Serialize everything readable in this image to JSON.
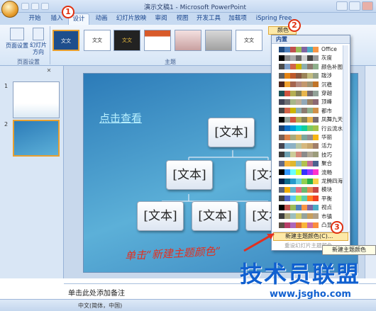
{
  "window": {
    "title": "演示文稿1 - Microsoft PowerPoint"
  },
  "tabs": [
    "开始",
    "插入",
    "设计",
    "动画",
    "幻灯片放映",
    "审阅",
    "视图",
    "开发工具",
    "加载项",
    "iSpring Free"
  ],
  "ribbon": {
    "page_setup": "页面设置",
    "slide_orientation": "幻灯片方向",
    "group_page_setup": "页面设置",
    "group_themes": "主题",
    "theme_thumbs": [
      "文文",
      "文文",
      "文文",
      "",
      "",
      "文文"
    ],
    "colors_button": "颜色"
  },
  "slide": {
    "link_text": "点击查看",
    "node_text": "[文本]"
  },
  "notes": {
    "placeholder": "单击此处添加备注"
  },
  "status": {
    "language": "中文(简体，中国)"
  },
  "dropdown": {
    "header": "内置",
    "themes": [
      {
        "name": "Office",
        "colors": [
          "#ffffff",
          "#1f497d",
          "#4f81bd",
          "#c0504d",
          "#9bbb59",
          "#8064a2",
          "#4bacc6",
          "#f79646"
        ]
      },
      {
        "name": "灰度",
        "colors": [
          "#ffffff",
          "#000000",
          "#888888",
          "#aaaaaa",
          "#666666",
          "#cccccc",
          "#444444",
          "#999999"
        ]
      },
      {
        "name": "颜色补图",
        "colors": [
          "#ffffff",
          "#4a4a4a",
          "#7f9fc9",
          "#d16349",
          "#ccb400",
          "#8cadae",
          "#8c7b70",
          "#8fb08c"
        ]
      },
      {
        "name": "跋涉",
        "colors": [
          "#ffffff",
          "#5e5e5e",
          "#e48312",
          "#bd582c",
          "#865640",
          "#9b8357",
          "#c2bc80",
          "#94a088"
        ]
      },
      {
        "name": "沉稳",
        "colors": [
          "#ffffff",
          "#4f271c",
          "#f0a22e",
          "#a5644e",
          "#b58b80",
          "#c3986d",
          "#a19574",
          "#c17529"
        ]
      },
      {
        "name": "穿越",
        "colors": [
          "#ffffff",
          "#1e5155",
          "#cf543f",
          "#b5ae53",
          "#848058",
          "#e8b54d",
          "#786c71",
          "#93a299"
        ]
      },
      {
        "name": "顶峰",
        "colors": [
          "#ffffff",
          "#424456",
          "#6f6f74",
          "#a7b789",
          "#beae98",
          "#92a9b9",
          "#9c8265",
          "#8d6974"
        ]
      },
      {
        "name": "都市",
        "colors": [
          "#ffffff",
          "#464646",
          "#d16349",
          "#ccb400",
          "#8cadae",
          "#8c7b70",
          "#8fb08c",
          "#d19049"
        ]
      },
      {
        "name": "凤舞九天",
        "colors": [
          "#ffffff",
          "#000000",
          "#93a299",
          "#cf543f",
          "#b5ae53",
          "#848058",
          "#e8b54d",
          "#786c71"
        ]
      },
      {
        "name": "行云流水",
        "colors": [
          "#ffffff",
          "#17406d",
          "#0f6fc6",
          "#009dd9",
          "#0bd0d9",
          "#10cf9b",
          "#7cca62",
          "#a5c249"
        ]
      },
      {
        "name": "华丽",
        "colors": [
          "#ffffff",
          "#775f55",
          "#dd8047",
          "#a5ab81",
          "#d8b25c",
          "#7ba79d",
          "#968c8c",
          "#f7b615"
        ]
      },
      {
        "name": "活力",
        "colors": [
          "#ffffff",
          "#454551",
          "#82b3d0",
          "#8eb1c4",
          "#b8c5a4",
          "#d6b87e",
          "#c8a66e",
          "#a27f69"
        ]
      },
      {
        "name": "技巧",
        "colors": [
          "#ffffff",
          "#3b3b3b",
          "#6ea0b0",
          "#cccc99",
          "#d28a7c",
          "#8c8c8c",
          "#b1a995",
          "#9c9c7b"
        ]
      },
      {
        "name": "聚合",
        "colors": [
          "#ffffff",
          "#646b86",
          "#f9b639",
          "#e0b72d",
          "#8cb9c2",
          "#b2c14d",
          "#c16c96",
          "#4c628f"
        ]
      },
      {
        "name": "流畅",
        "colors": [
          "#ffffff",
          "#000000",
          "#3399ff",
          "#69ffff",
          "#ccff33",
          "#3333ff",
          "#9933ff",
          "#ff33cc"
        ]
      },
      {
        "name": "龙腾四海",
        "colors": [
          "#ffffff",
          "#03224a",
          "#0d6b8c",
          "#269acc",
          "#6ad1e3",
          "#92d050",
          "#27b24c",
          "#f8d14a"
        ]
      },
      {
        "name": "模块",
        "colors": [
          "#ffffff",
          "#5a6378",
          "#f0ad00",
          "#60b5cc",
          "#e66c7d",
          "#6bb76d",
          "#e88651",
          "#c64847"
        ]
      },
      {
        "name": "平衡",
        "colors": [
          "#ffffff",
          "#3f3f3f",
          "#4e67c8",
          "#5eccf3",
          "#a7ea52",
          "#5dceaf",
          "#ff8021",
          "#f14124"
        ]
      },
      {
        "name": "视点",
        "colors": [
          "#ffffff",
          "#000000",
          "#c0504d",
          "#9bbb59",
          "#4f81bd",
          "#f79646",
          "#8064a2",
          "#4bacc6"
        ]
      },
      {
        "name": "市镇",
        "colors": [
          "#ffffff",
          "#3d3d3d",
          "#a9a57c",
          "#9cbebd",
          "#d2cb6c",
          "#95a39d",
          "#c89f5d",
          "#b1a089"
        ]
      },
      {
        "name": "凸显",
        "colors": [
          "#ffffff",
          "#5b4f45",
          "#b83d68",
          "#ac66bb",
          "#de6c36",
          "#f9b639",
          "#cf6da4",
          "#fa8d3d"
        ]
      }
    ],
    "new_colors": "新建主题颜色(C)...",
    "reset_colors": "重设幻灯片主题颜色"
  },
  "tooltip": "新建主题颜色",
  "annotations": {
    "step1": "1",
    "step2": "2",
    "step3": "3",
    "caption": "单击“新建主题颜色”"
  },
  "watermark": {
    "main": "技术员联盟",
    "url": "www.jsgho.com"
  }
}
